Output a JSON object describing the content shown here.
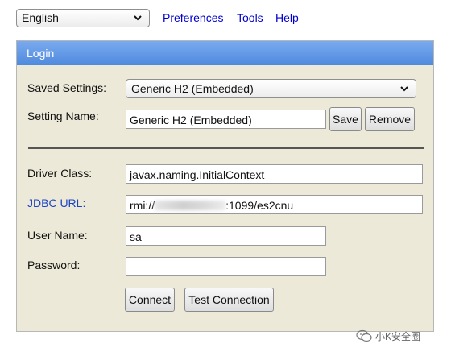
{
  "toolbar": {
    "language": "English",
    "links": [
      "Preferences",
      "Tools",
      "Help"
    ]
  },
  "login": {
    "title": "Login",
    "saved_settings_label": "Saved Settings:",
    "saved_settings_value": "Generic H2 (Embedded)",
    "setting_name_label": "Setting Name:",
    "setting_name_value": "Generic H2 (Embedded)",
    "save_label": "Save",
    "remove_label": "Remove",
    "driver_class_label": "Driver Class:",
    "driver_class_value": "javax.naming.InitialContext",
    "jdbc_url_label": "JDBC URL:",
    "jdbc_url_prefix": "rmi://",
    "jdbc_url_suffix": ":1099/es2cnu",
    "user_name_label": "User Name:",
    "user_name_value": "sa",
    "password_label": "Password:",
    "password_value": "",
    "connect_label": "Connect",
    "test_connection_label": "Test Connection"
  },
  "watermark": {
    "text": "小K安全圈"
  },
  "colors": {
    "header_gradient_top": "#7aaaee",
    "header_gradient_bottom": "#4f8ade",
    "panel_background": "#ece9d8",
    "link": "#0000cc"
  }
}
